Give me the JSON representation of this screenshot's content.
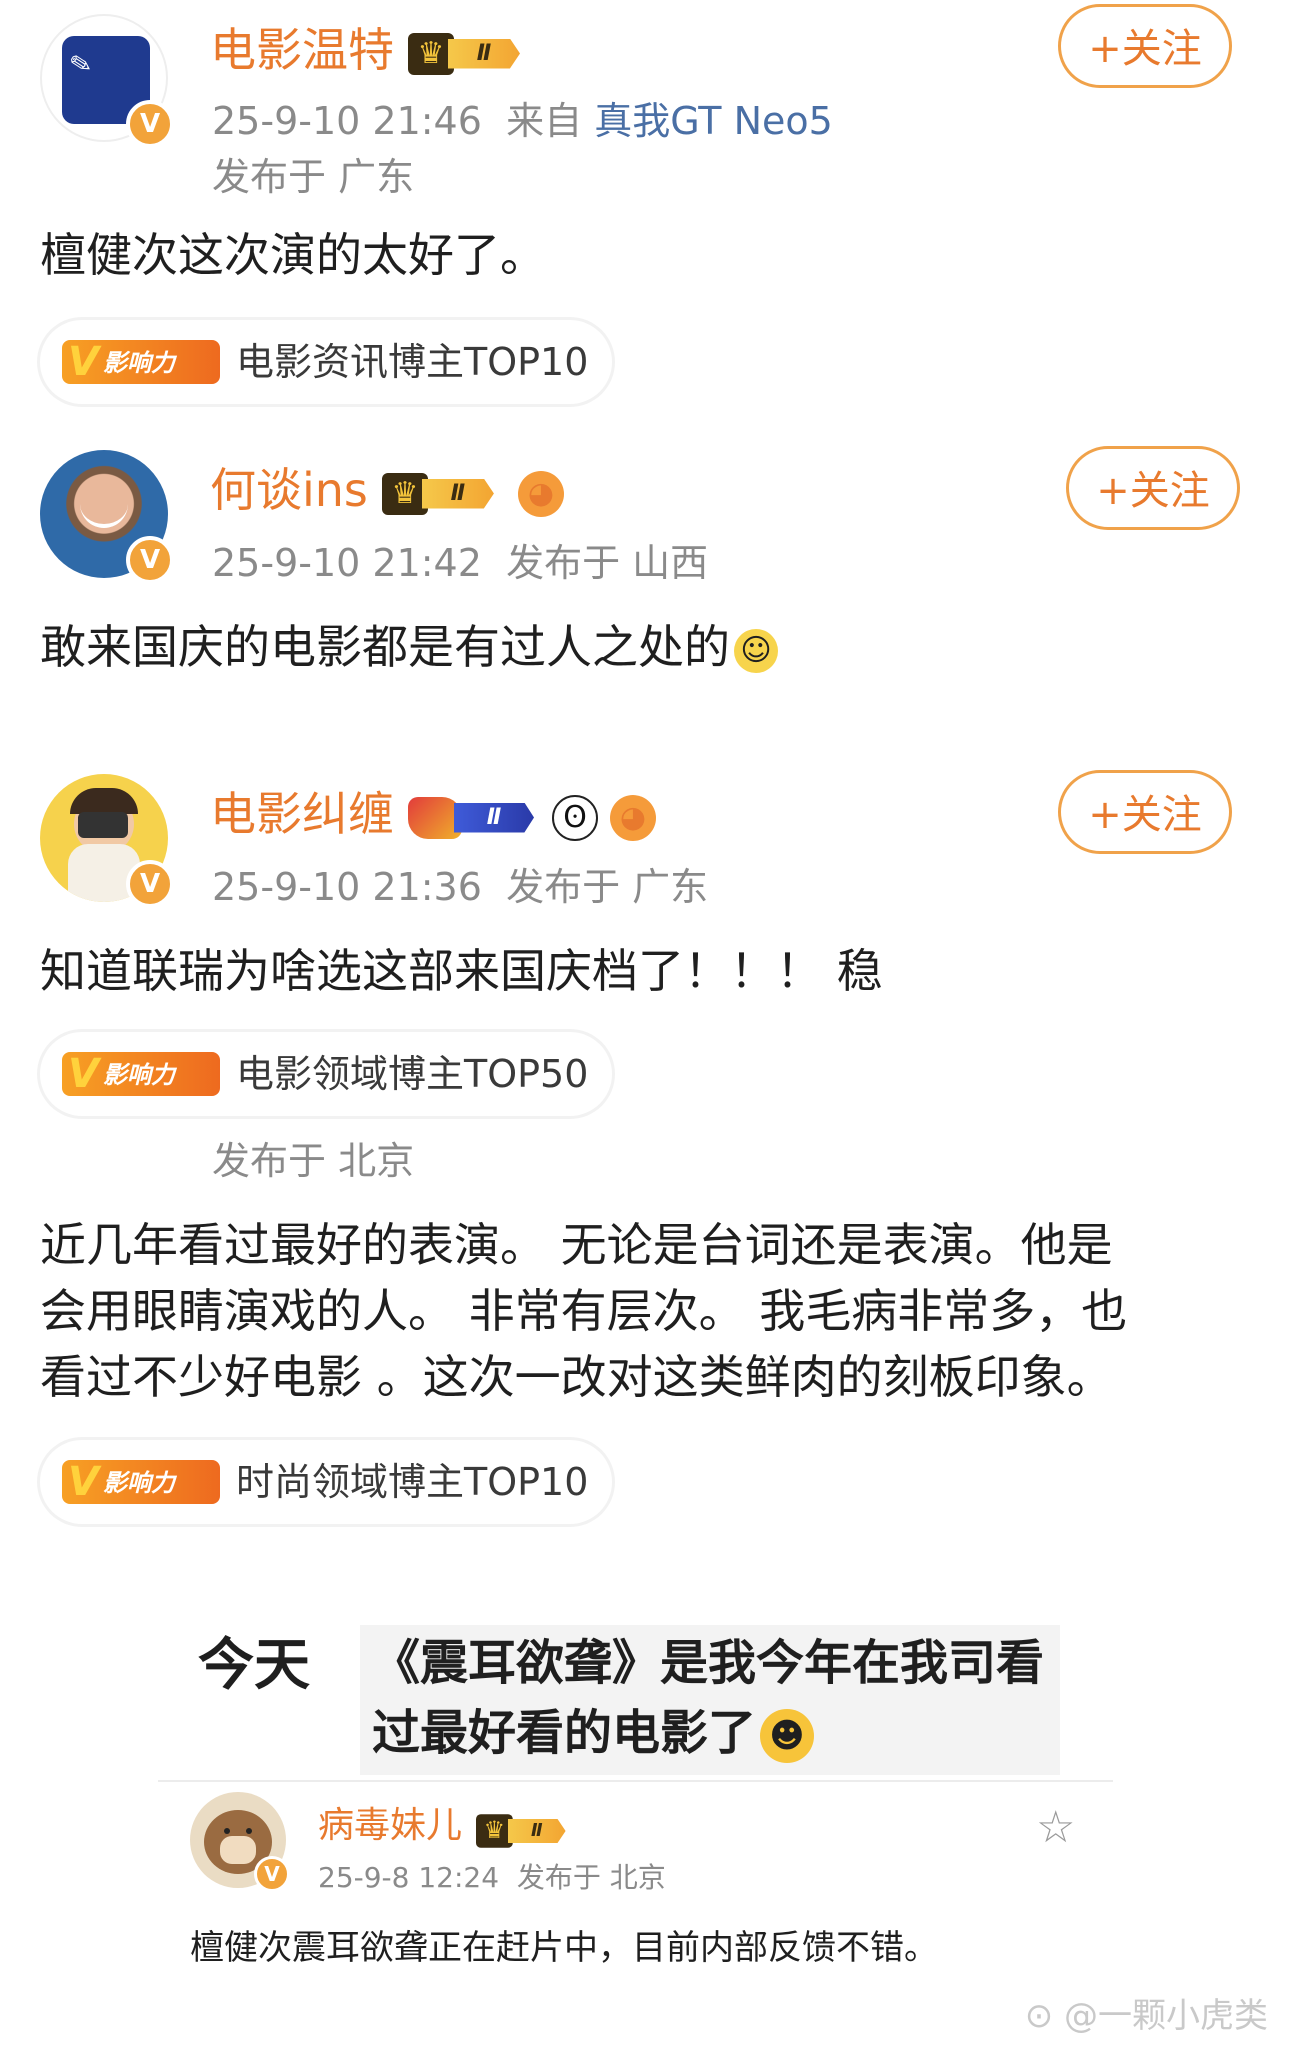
{
  "colors": {
    "username": "#e87a2e",
    "meta": "#8a8a8a",
    "device_link": "#4a6fa5",
    "follow_border": "#f0a24a",
    "influence_badge": "#f7a024"
  },
  "posts": [
    {
      "username": "电影温特",
      "level_badge": "Ⅱ",
      "time": "25-9-10 21:46",
      "source_prefix": "来自",
      "device": "真我GT Neo5",
      "location": "发布于 广东",
      "follow_label": "+关注",
      "content": "檀健次这次演的太好了。",
      "influence_label": "影响力",
      "influence_text": "电影资讯博主TOP10"
    },
    {
      "username": "何谈ins",
      "level_badge": "Ⅱ",
      "time": "25-9-10 21:42",
      "location": "发布于 山西",
      "follow_label": "+关注",
      "content": "敢来国庆的电影都是有过人之处的"
    },
    {
      "username": "电影纠缠",
      "level_badge": "Ⅱ",
      "time": "25-9-10 21:36",
      "location": "发布于 广东",
      "follow_label": "+关注",
      "content": "知道联瑞为啥选这部来国庆档了！！！ 稳",
      "influence_label": "影响力",
      "influence_text": "电影领域博主TOP50"
    },
    {
      "location": "发布于 北京",
      "content_lines": [
        "近几年看过最好的表演。 无论是台词还是表演。他是",
        "会用眼睛演戏的人。 非常有层次。 我毛病非常多，也",
        "看过不少好电影 。这次一改对这类鲜肉的刻板印象。"
      ],
      "influence_label": "影响力",
      "influence_text": "时尚领域博主TOP10"
    }
  ],
  "embedded": {
    "today_label": "今天",
    "quote_lines": [
      "《震耳欲聋》是我今年在我司看",
      "过最好看的电影了"
    ],
    "username": "病毒妹儿",
    "level_badge": "Ⅱ",
    "time": "25-9-8 12:24",
    "location": "发布于 北京",
    "content": "檀健次震耳欲聋正在赶片中，目前内部反馈不错。"
  },
  "watermark": "@一颗小虎类"
}
